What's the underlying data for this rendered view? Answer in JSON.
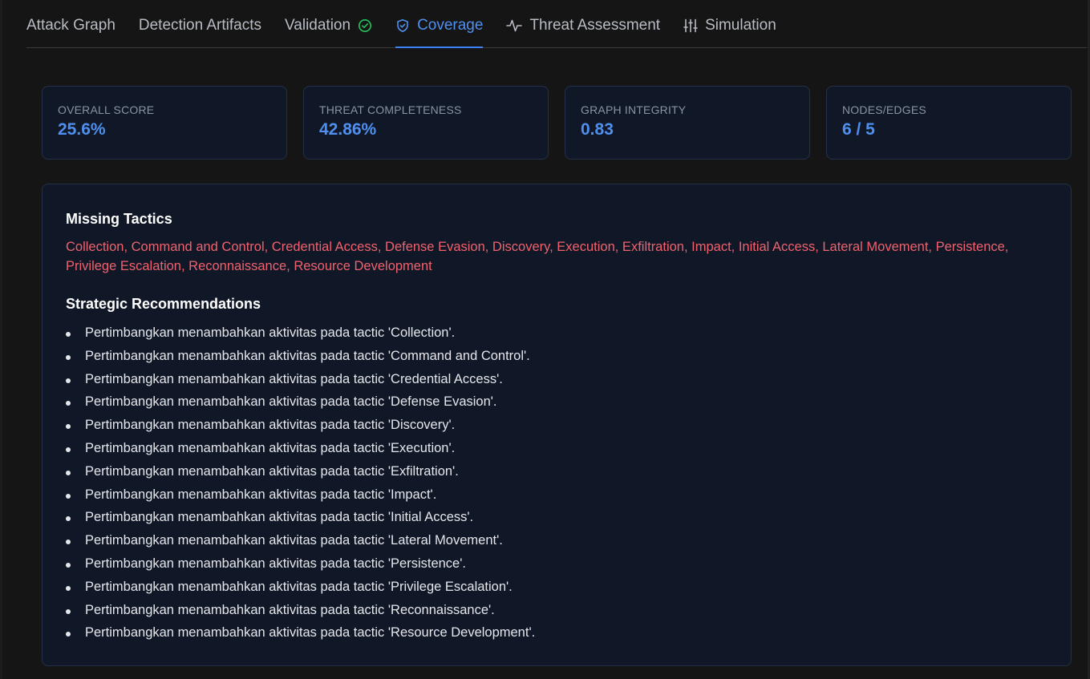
{
  "tabs": [
    {
      "label": "Attack Graph"
    },
    {
      "label": "Detection Artifacts"
    },
    {
      "label": "Validation",
      "icon": "check-circle-icon"
    },
    {
      "label": "Coverage",
      "icon": "shield-check-icon",
      "active": true
    },
    {
      "label": "Threat Assessment",
      "icon": "activity-icon"
    },
    {
      "label": "Simulation",
      "icon": "sliders-icon"
    }
  ],
  "metrics": [
    {
      "label": "OVERALL SCORE",
      "value": "25.6%"
    },
    {
      "label": "THREAT COMPLETENESS",
      "value": "42.86%"
    },
    {
      "label": "GRAPH INTEGRITY",
      "value": "0.83"
    },
    {
      "label": "NODES/EDGES",
      "value": "6 / 5"
    }
  ],
  "missing_tactics": {
    "title": "Missing Tactics",
    "text": "Collection, Command and Control, Credential Access, Defense Evasion, Discovery, Execution, Exfiltration, Impact, Initial Access, Lateral Movement, Persistence, Privilege Escalation, Reconnaissance, Resource Development"
  },
  "recommendations": {
    "title": "Strategic Recommendations",
    "items": [
      "Pertimbangkan menambahkan aktivitas pada tactic 'Collection'.",
      "Pertimbangkan menambahkan aktivitas pada tactic 'Command and Control'.",
      "Pertimbangkan menambahkan aktivitas pada tactic 'Credential Access'.",
      "Pertimbangkan menambahkan aktivitas pada tactic 'Defense Evasion'.",
      "Pertimbangkan menambahkan aktivitas pada tactic 'Discovery'.",
      "Pertimbangkan menambahkan aktivitas pada tactic 'Execution'.",
      "Pertimbangkan menambahkan aktivitas pada tactic 'Exfiltration'.",
      "Pertimbangkan menambahkan aktivitas pada tactic 'Impact'.",
      "Pertimbangkan menambahkan aktivitas pada tactic 'Initial Access'.",
      "Pertimbangkan menambahkan aktivitas pada tactic 'Lateral Movement'.",
      "Pertimbangkan menambahkan aktivitas pada tactic 'Persistence'.",
      "Pertimbangkan menambahkan aktivitas pada tactic 'Privilege Escalation'.",
      "Pertimbangkan menambahkan aktivitas pada tactic 'Reconnaissance'.",
      "Pertimbangkan menambahkan aktivitas pada tactic 'Resource Development'."
    ]
  },
  "colors": {
    "accent": "#3b82f6",
    "success": "#22c55e",
    "danger": "#f0616d",
    "card_bg": "#101828"
  }
}
